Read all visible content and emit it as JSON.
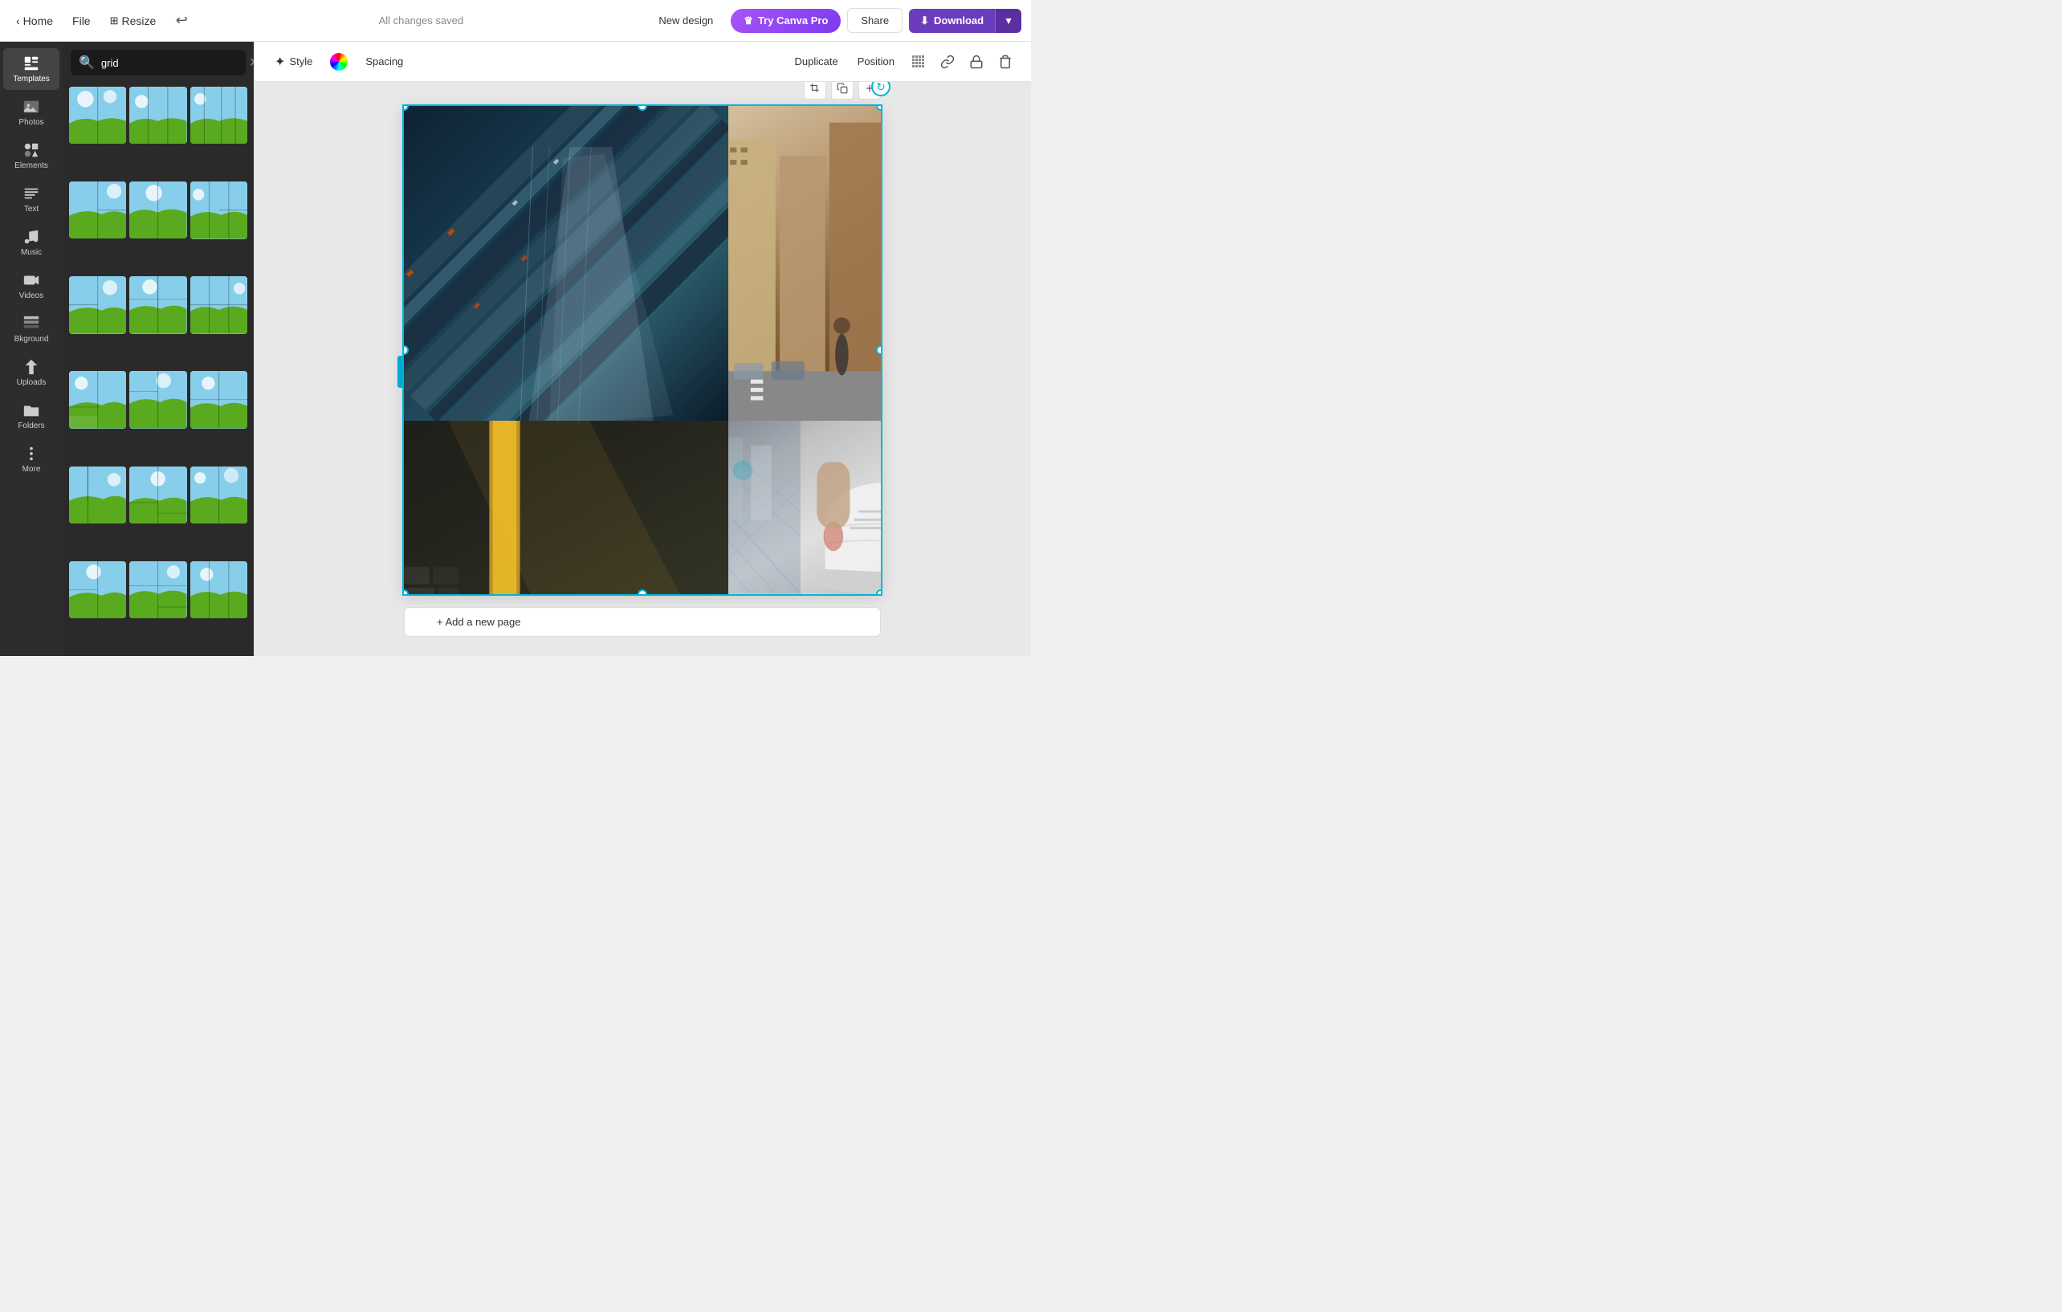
{
  "navbar": {
    "home_label": "Home",
    "file_label": "File",
    "resize_label": "Resize",
    "saved_label": "All changes saved",
    "new_design_label": "New design",
    "try_pro_label": "Try Canva Pro",
    "share_label": "Share",
    "download_label": "Download"
  },
  "sidebar": {
    "items": [
      {
        "id": "templates",
        "label": "Templates"
      },
      {
        "id": "photos",
        "label": "Photos"
      },
      {
        "id": "elements",
        "label": "Elements"
      },
      {
        "id": "text",
        "label": "Text"
      },
      {
        "id": "music",
        "label": "Music"
      },
      {
        "id": "videos",
        "label": "Videos"
      },
      {
        "id": "background",
        "label": "Bkground"
      },
      {
        "id": "uploads",
        "label": "Uploads"
      },
      {
        "id": "folders",
        "label": "Folders"
      },
      {
        "id": "more",
        "label": "More"
      }
    ]
  },
  "search": {
    "value": "grid",
    "placeholder": "Search templates"
  },
  "toolbar": {
    "style_label": "Style",
    "spacing_label": "Spacing",
    "duplicate_label": "Duplicate",
    "position_label": "Position"
  },
  "canvas": {
    "add_page_label": "+ Add a new page"
  }
}
